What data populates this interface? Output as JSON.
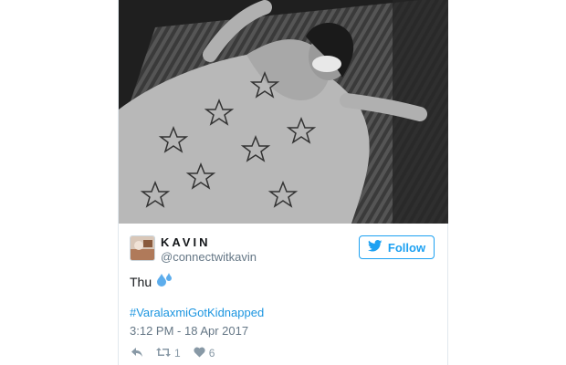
{
  "tweet": {
    "display_name": "KAVIN",
    "handle": "@connectwitkavin",
    "follow_label": "Follow",
    "text": "Thu",
    "hashtag": "#VaralaxmiGotKidnapped",
    "timestamp": "3:12 PM - 18 Apr 2017",
    "retweet_count": "1",
    "like_count": "6",
    "icons": {
      "reply": "reply-icon",
      "retweet": "retweet-icon",
      "like": "heart-icon",
      "follow": "twitter-bird-icon",
      "emoji": "sweat-droplets-emoji"
    }
  },
  "colors": {
    "accent": "#1da1f2",
    "link": "#1b95e0",
    "muted": "#657786",
    "action_gray": "#8899a6",
    "text": "#14171a"
  }
}
